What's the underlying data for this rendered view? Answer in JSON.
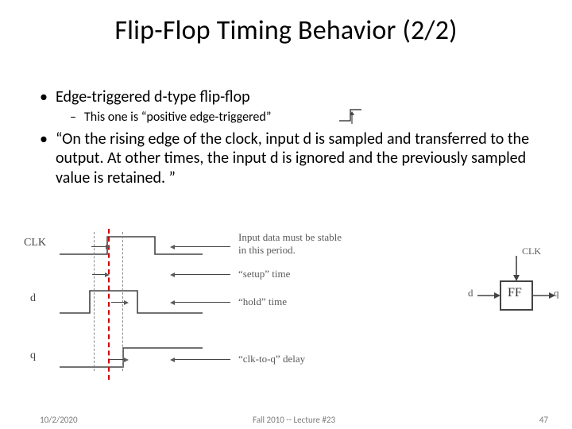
{
  "title": "Flip-Flop Timing Behavior (2/2)",
  "bullets": {
    "b1": "Edge-triggered d-type flip-flop",
    "b1_sub": "This one is “positive edge-triggered”",
    "b2": "“On the rising edge of the clock, input d is sampled and transferred to the output. At other times, the input d is ignored and the previously sampled value is retained. ”"
  },
  "diagram": {
    "signals": {
      "clk": "CLK",
      "d": "d",
      "q": "q"
    },
    "annotations": {
      "stable1": "Input data must be stable",
      "stable2": "in this period.",
      "setup": "“setup” time",
      "hold": "“hold” time",
      "clk2q": "“clk-to-q” delay"
    },
    "ff": {
      "clk": "CLK",
      "d": "d",
      "box": "FF",
      "q": "q"
    }
  },
  "footer": {
    "date": "10/2/2020",
    "mid": "Fall 2010 -- Lecture #23",
    "page": "47"
  }
}
